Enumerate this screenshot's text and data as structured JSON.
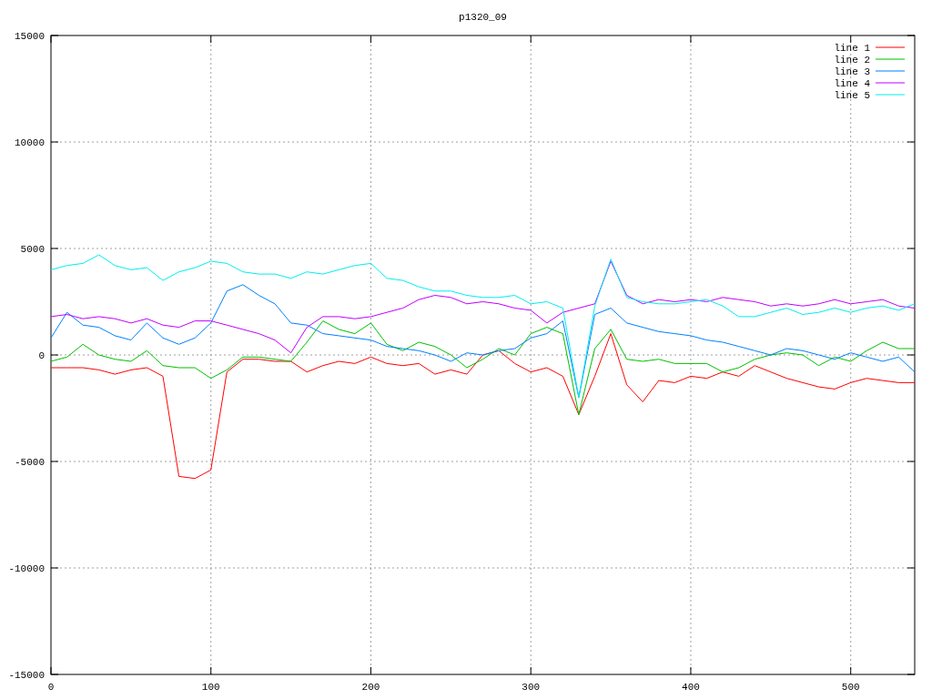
{
  "chart_data": {
    "type": "line",
    "title": "p1320_09",
    "grid": true,
    "legend": true,
    "x": [
      0,
      10,
      20,
      30,
      40,
      50,
      60,
      70,
      80,
      90,
      100,
      110,
      120,
      130,
      140,
      150,
      160,
      170,
      180,
      190,
      200,
      210,
      220,
      230,
      240,
      250,
      260,
      270,
      280,
      290,
      300,
      310,
      320,
      330,
      340,
      350,
      360,
      370,
      380,
      390,
      400,
      410,
      420,
      430,
      440,
      450,
      460,
      470,
      480,
      490,
      500,
      510,
      520,
      530,
      540
    ],
    "xlim": [
      0,
      540
    ],
    "ylim": [
      -15000,
      15000
    ],
    "xticks": [
      0,
      100,
      200,
      300,
      400,
      500
    ],
    "yticks": [
      -15000,
      -10000,
      -5000,
      0,
      5000,
      10000,
      15000
    ],
    "series": [
      {
        "name": "line 1",
        "color": "#ff0000",
        "values": [
          -600,
          -600,
          -600,
          -700,
          -900,
          -700,
          -600,
          -1000,
          -5700,
          -5800,
          -5400,
          -800,
          -200,
          -200,
          -300,
          -300,
          -800,
          -500,
          -300,
          -400,
          -100,
          -400,
          -500,
          -400,
          -900,
          -700,
          -900,
          0,
          200,
          -400,
          -800,
          -600,
          -1000,
          -2800,
          -1000,
          1000,
          -1400,
          -2200,
          -1200,
          -1300,
          -1000,
          -1100,
          -800,
          -1000,
          -500,
          -800,
          -1100,
          -1300,
          -1500,
          -1600,
          -1300,
          -1100,
          -1200,
          -1300,
          -1300
        ]
      },
      {
        "name": "line 2",
        "color": "#00c000",
        "values": [
          -300,
          -100,
          500,
          0,
          -200,
          -300,
          200,
          -500,
          -600,
          -600,
          -1100,
          -700,
          -100,
          -100,
          -200,
          -300,
          600,
          1600,
          1200,
          1000,
          1500,
          500,
          200,
          600,
          400,
          0,
          -600,
          -200,
          300,
          0,
          1000,
          1300,
          1000,
          -2800,
          300,
          1200,
          -200,
          -300,
          -200,
          -400,
          -400,
          -400,
          -800,
          -600,
          -200,
          0,
          100,
          0,
          -500,
          -100,
          -300,
          200,
          600,
          300,
          300
        ]
      },
      {
        "name": "line 3",
        "color": "#0080ff",
        "values": [
          800,
          2000,
          1400,
          1300,
          900,
          700,
          1500,
          800,
          500,
          800,
          1500,
          3000,
          3300,
          2800,
          2400,
          1500,
          1400,
          1000,
          900,
          800,
          700,
          400,
          300,
          200,
          0,
          -300,
          100,
          0,
          200,
          300,
          800,
          1000,
          1600,
          -2000,
          1900,
          2200,
          1500,
          1300,
          1100,
          1000,
          900,
          700,
          600,
          400,
          200,
          0,
          300,
          200,
          0,
          -200,
          100,
          -100,
          -300,
          -100,
          -800
        ]
      },
      {
        "name": "line 4",
        "color": "#c000ff",
        "values": [
          1800,
          1900,
          1700,
          1800,
          1700,
          1500,
          1700,
          1400,
          1300,
          1600,
          1600,
          1400,
          1200,
          1000,
          700,
          100,
          1300,
          1800,
          1800,
          1700,
          1800,
          2000,
          2200,
          2600,
          2800,
          2700,
          2400,
          2500,
          2400,
          2200,
          2100,
          1500,
          2000,
          2200,
          2400,
          4400,
          2800,
          2400,
          2600,
          2500,
          2600,
          2500,
          2700,
          2600,
          2500,
          2300,
          2400,
          2300,
          2400,
          2600,
          2400,
          2500,
          2600,
          2300,
          2200
        ]
      },
      {
        "name": "line 5",
        "color": "#00eeee",
        "values": [
          4000,
          4200,
          4300,
          4700,
          4200,
          4000,
          4100,
          3500,
          3900,
          4100,
          4400,
          4300,
          3900,
          3800,
          3800,
          3600,
          3900,
          3800,
          4000,
          4200,
          4300,
          3600,
          3500,
          3200,
          3000,
          3000,
          2800,
          2700,
          2700,
          2800,
          2400,
          2500,
          2200,
          -2000,
          2300,
          4500,
          2700,
          2500,
          2400,
          2400,
          2500,
          2600,
          2300,
          1800,
          1800,
          2000,
          2200,
          1900,
          2000,
          2200,
          2000,
          2200,
          2300,
          2100,
          2400
        ]
      }
    ]
  }
}
